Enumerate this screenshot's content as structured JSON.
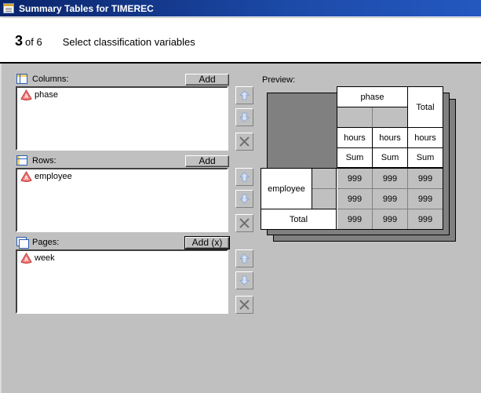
{
  "window": {
    "title": "Summary Tables for TIMEREC",
    "icon": "table-icon"
  },
  "wizard": {
    "step": "3",
    "of_label": "of 6",
    "description": "Select classification variables"
  },
  "sections": {
    "columns": {
      "label": "Columns:",
      "icon": "columns-icon",
      "add_label": "Add",
      "items": [
        "phase"
      ]
    },
    "rows": {
      "label": "Rows:",
      "icon": "rows-icon",
      "add_label": "Add",
      "items": [
        "employee"
      ]
    },
    "pages": {
      "label": "Pages:",
      "icon": "pages-icon",
      "add_label": "Add (x)",
      "items": [
        "week"
      ]
    }
  },
  "side_buttons": {
    "up": "move-up",
    "down": "move-down",
    "remove": "remove"
  },
  "preview": {
    "label": "Preview:",
    "col_var": "phase",
    "total_label": "Total",
    "analysis_var": "hours",
    "stat": "Sum",
    "row_var": "employee",
    "row_total": "Total",
    "cell_value": "999"
  }
}
